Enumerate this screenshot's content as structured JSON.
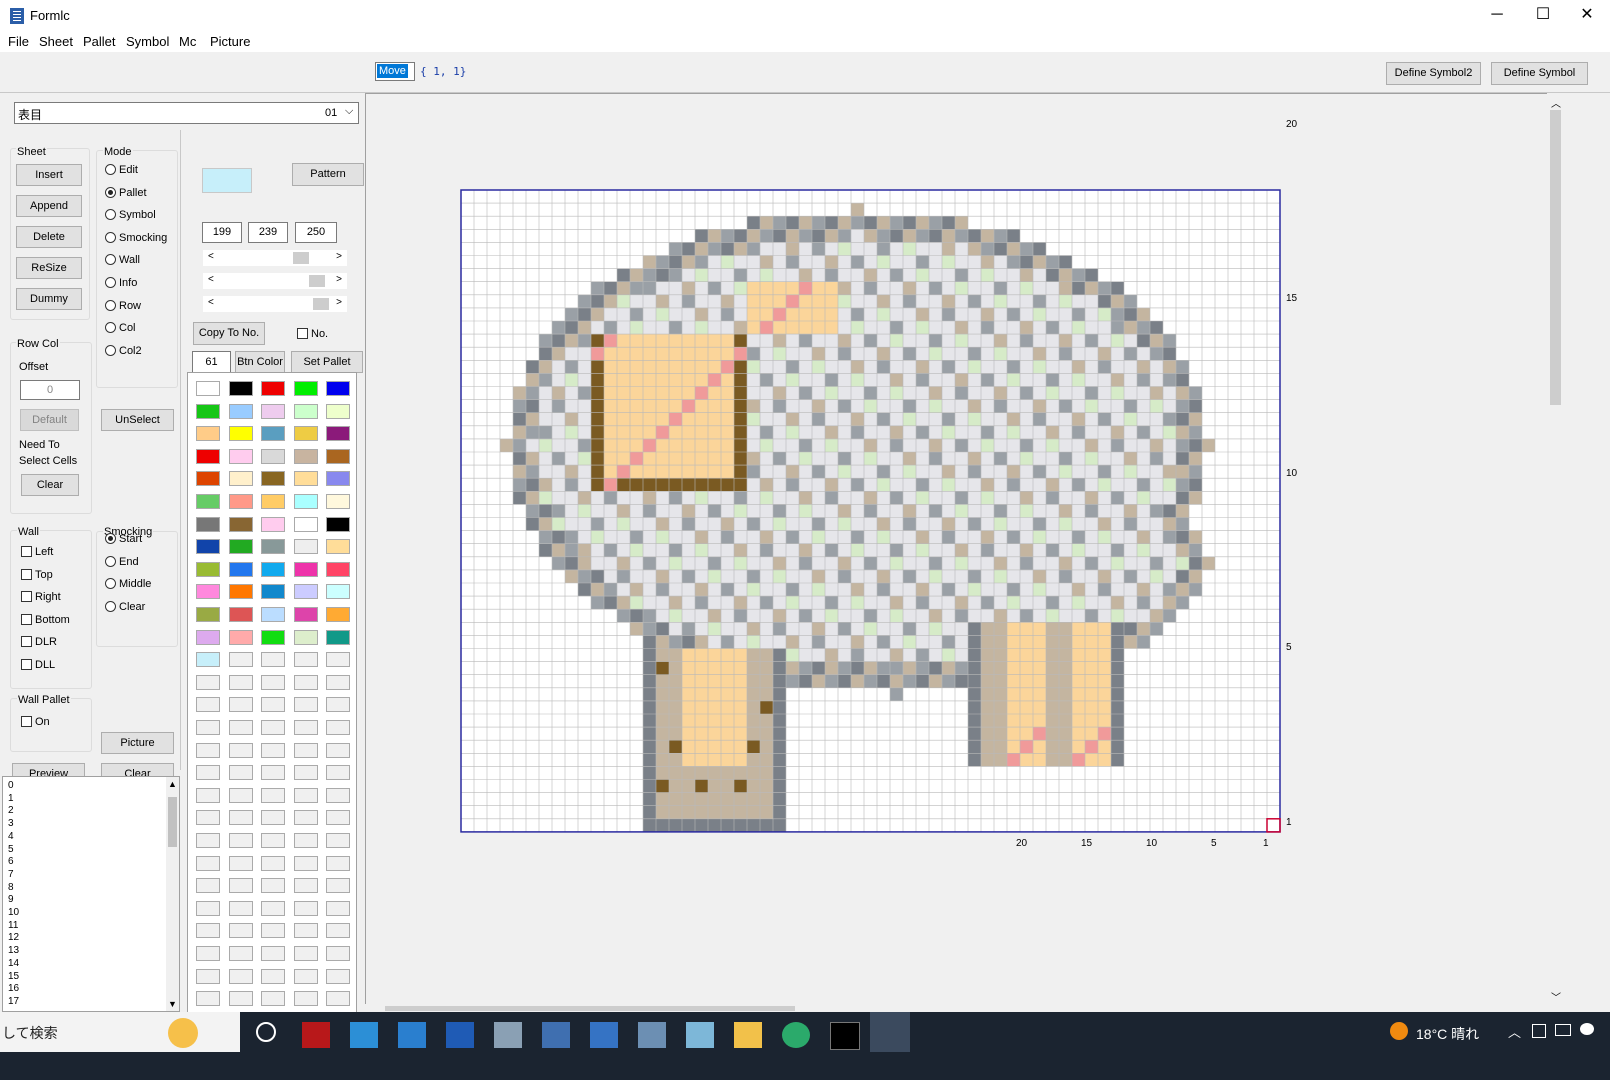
{
  "window": {
    "title": "Formlc",
    "minimize": "─",
    "maximize": "☐",
    "close": "✕"
  },
  "menu": [
    "File",
    "Sheet",
    "Pallet",
    "Symbol",
    "Mc",
    "Picture"
  ],
  "toolbar": {
    "move_value": "Move",
    "coord_text": "{ 1, 1}",
    "define_symbol2": "Define Symbol2",
    "define_symbol": "Define Symbol"
  },
  "sheet_combo": {
    "value": "表目",
    "number": "01"
  },
  "sheet_group": {
    "title": "Sheet",
    "insert": "Insert",
    "append": "Append",
    "delete": "Delete",
    "resize": "ReSize",
    "dummy": "Dummy"
  },
  "mode_group": {
    "title": "Mode",
    "options": [
      "Edit",
      "Pallet",
      "Symbol",
      "Smocking",
      "Wall",
      "Info",
      "Row",
      "Col",
      "Col2"
    ],
    "selected": "Pallet"
  },
  "rowcol_group": {
    "title": "Row Col",
    "offset_label": "Offset",
    "offset_value": "0",
    "default_label": "Default",
    "note_line1": "Need To",
    "note_line2": "Select Cells",
    "clear": "Clear"
  },
  "unselect": "UnSelect",
  "wall_group": {
    "title": "Wall",
    "options": [
      "Left",
      "Top",
      "Right",
      "Bottom",
      "DLR",
      "DLL"
    ]
  },
  "smocking_group": {
    "title": "Smocking",
    "options": [
      "Start",
      "End",
      "Middle",
      "Clear"
    ],
    "selected": "Start"
  },
  "wall_pallet_group": {
    "title": "Wall Pallet",
    "on_label": "On"
  },
  "picture_button": "Picture",
  "preview_button": "Preview",
  "clear_button": "Clear",
  "color_editor": {
    "current_color": "#c7effa",
    "pattern": "Pattern",
    "r": "199",
    "g": "239",
    "b": "250",
    "copy_to_no": "Copy To No.",
    "no_label": "No.",
    "index_value": "61",
    "btn_color": "Btn Color",
    "set_pallet": "Set Pallet",
    "slider_levels": [
      199,
      239,
      250
    ]
  },
  "palette_colors": [
    "#ffffff",
    "#000000",
    "#ee0000",
    "#00ee00",
    "#0000ee",
    "#16c616",
    "#99ccff",
    "#eeccee",
    "#ccffcc",
    "#eeffcc",
    "#ffcc88",
    "#ffff00",
    "#5a9ec0",
    "#eecc44",
    "#8b1a7a",
    "#ee0000",
    "#ffccee",
    "#d9d9d9",
    "#c8b4a0",
    "#aa6620",
    "#dd4400",
    "#fff0cc",
    "#886622",
    "#ffdd99",
    "#8888ee",
    "#66cc66",
    "#ff9988",
    "#ffcc66",
    "#aaffff",
    "#fff8dd",
    "#777777",
    "#886633",
    "#ffccee",
    "#ffffff",
    "#000000",
    "#1144aa",
    "#22aa22",
    "#889999",
    "#eeeeee",
    "#ffdd99",
    "#99bb33",
    "#2277ee",
    "#11aaee",
    "#ee33aa",
    "#ff4466",
    "#ff88dd",
    "#ff7700",
    "#1188cc",
    "#ccccff",
    "#ccffff",
    "#99aa44",
    "#dd5555",
    "#bbddff",
    "#dd44aa",
    "#ffaa33",
    "#ddaaee",
    "#ffaaaa",
    "#11dd11",
    "#ddeecc",
    "#119988",
    "#c7effa"
  ],
  "list_items": [
    "0",
    "1",
    "2",
    "3",
    "4",
    "5",
    "6",
    "7",
    "8",
    "9",
    "10",
    "11",
    "12",
    "13",
    "14",
    "15",
    "16",
    "17"
  ],
  "grid": {
    "cols": 63,
    "rows": 49,
    "right_axis": [
      {
        "label": "20",
        "row_from_bottom": 16
      },
      {
        "label": "15",
        "row_from_bottom": 12
      },
      {
        "label": "10",
        "row_from_bottom": 8
      },
      {
        "label": "5",
        "row_from_bottom": 4
      },
      {
        "label": "1",
        "row_from_bottom": 0
      }
    ],
    "bottom_axis": [
      {
        "label": "20",
        "col_from_right": 20
      },
      {
        "label": "15",
        "col_from_right": 15
      },
      {
        "label": "10",
        "col_from_right": 10
      },
      {
        "label": "5",
        "col_from_right": 5
      },
      {
        "label": "1",
        "col_from_right": 1
      }
    ],
    "sheep_colors": {
      "dark_gray": "#7a8088",
      "gray": "#9aa0a6",
      "tan": "#c4b5a0",
      "light": "#e6e6ea",
      "mint": "#d6ebc8",
      "face": "#fbd59a",
      "brown": "#7a5a22",
      "pink": "#f09a9a"
    }
  },
  "taskbar": {
    "search_text": "して検索",
    "weather": "18°C 晴れ"
  }
}
